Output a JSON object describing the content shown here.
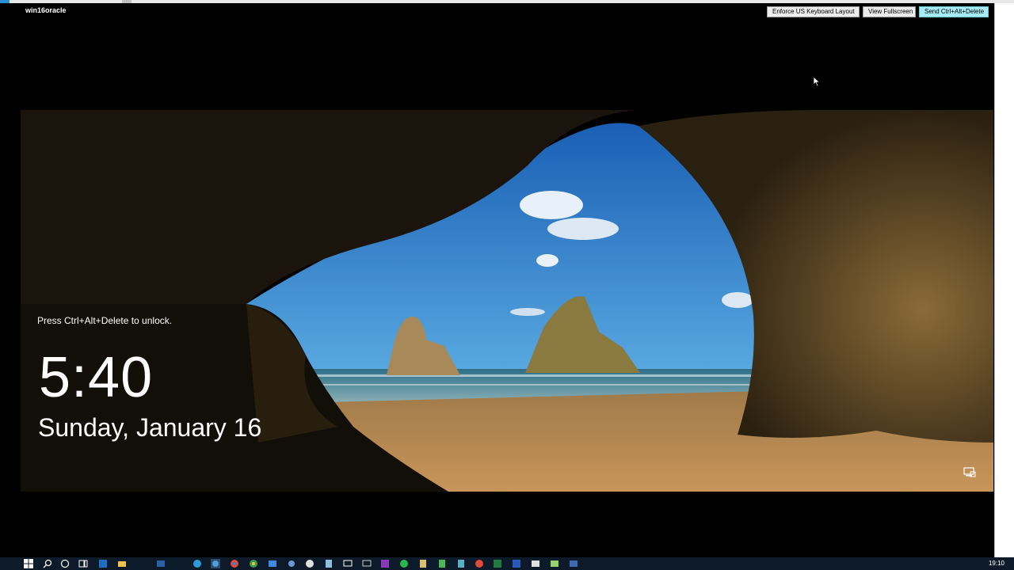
{
  "session": {
    "title": "win16oracle",
    "buttons": {
      "keyboard": "Enforce US Keyboard Layout",
      "fullscreen": "View Fullscreen",
      "cad": "Send Ctrl+Alt+Delete"
    }
  },
  "lockscreen": {
    "prompt": "Press Ctrl+Alt+Delete to unlock.",
    "time": "5:40",
    "date": "Sunday, January 16"
  },
  "taskbar": {
    "time": "19:10",
    "icons": [
      "windows-start-icon",
      "search-icon",
      "cortana-icon",
      "task-view-icon",
      "outlook-icon",
      "file-explorer-icon",
      "powershell-icon",
      "edge-icon",
      "ie-icon",
      "chrome-icon",
      "chrome-icon",
      "app-icon",
      "network-icon",
      "chrome-icon",
      "remote-desktop-icon",
      "onenote-icon",
      "spotify-icon",
      "notepad-icon",
      "green-app-icon",
      "chrome-icon",
      "excel-icon",
      "word-icon",
      "terminal-icon",
      "console-icon",
      "snipping-icon"
    ]
  },
  "colors": {
    "accent": "#a6ecf4",
    "taskbar": "#0c1a2a",
    "sky": "#2a78c8",
    "sand": "#b88a52",
    "rock": "#6b5a3a"
  }
}
